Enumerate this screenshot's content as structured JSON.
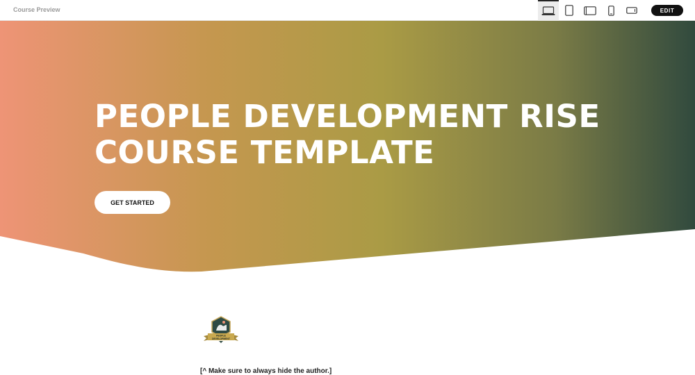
{
  "app": {
    "title": "Course Preview"
  },
  "toolbar": {
    "devices": [
      {
        "icon": "laptop-icon",
        "label": "Desktop",
        "active": true
      },
      {
        "icon": "tablet-icon",
        "label": "Tablet portrait",
        "active": false
      },
      {
        "icon": "tablet-landscape-icon",
        "label": "Tablet landscape",
        "active": false
      },
      {
        "icon": "phone-icon",
        "label": "Phone portrait",
        "active": false
      },
      {
        "icon": "phone-landscape-icon",
        "label": "Phone landscape",
        "active": false
      }
    ],
    "edit_label": "EDIT"
  },
  "hero": {
    "title": "PEOPLE DEVELOPMENT RISE COURSE TEMPLATE",
    "cta_label": "GET STARTED",
    "gradient": [
      "#ee9476",
      "#c5974f",
      "#aa9b45",
      "#7a7b46",
      "#314a3e"
    ]
  },
  "content": {
    "logo": {
      "icon": "people-development-badge-icon",
      "line1": "PEOPLE",
      "line2": "DEVELOPMENT"
    },
    "note": "[^ Make sure to always hide the author.]"
  }
}
